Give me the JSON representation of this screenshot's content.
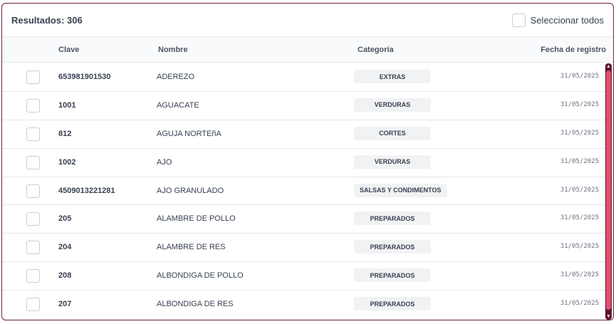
{
  "toolbar": {
    "results_label": "Resultados: 306",
    "select_all_label": "Seleccionar todos"
  },
  "table": {
    "columns": {
      "clave": "Clave",
      "nombre": "Nombre",
      "categoria": "Categoría",
      "fecha": "Fecha de registro"
    },
    "rows": [
      {
        "clave": "653981901530",
        "nombre": "ADEREZO",
        "categoria": "EXTRAS",
        "fecha": "31/05/2025"
      },
      {
        "clave": "1001",
        "nombre": "AGUACATE",
        "categoria": "VERDURAS",
        "fecha": "31/05/2025"
      },
      {
        "clave": "812",
        "nombre": "AGUJA NORTEñA",
        "categoria": "CORTES",
        "fecha": "31/05/2025"
      },
      {
        "clave": "1002",
        "nombre": "AJO",
        "categoria": "VERDURAS",
        "fecha": "31/05/2025"
      },
      {
        "clave": "4509013221281",
        "nombre": "AJO GRANULADO",
        "categoria": "SALSAS Y CONDIMENTOS",
        "fecha": "31/05/2025"
      },
      {
        "clave": "205",
        "nombre": "ALAMBRE DE POLLO",
        "categoria": "PREPARADOS",
        "fecha": "31/05/2025"
      },
      {
        "clave": "204",
        "nombre": "ALAMBRE DE RES",
        "categoria": "PREPARADOS",
        "fecha": "31/05/2025"
      },
      {
        "clave": "208",
        "nombre": "ALBONDIGA DE POLLO",
        "categoria": "PREPARADOS",
        "fecha": "31/05/2025"
      },
      {
        "clave": "207",
        "nombre": "ALBONDIGA DE RES",
        "categoria": "PREPARADOS",
        "fecha": "31/05/2025"
      }
    ]
  },
  "colors": {
    "border_accent": "#6b2240",
    "scrollbar_track": "#5a1530",
    "scrollbar_thumb": "#e44d6c"
  },
  "icons": {
    "scroll_up": "chevron-up-icon",
    "scroll_down": "chevron-down-icon"
  }
}
